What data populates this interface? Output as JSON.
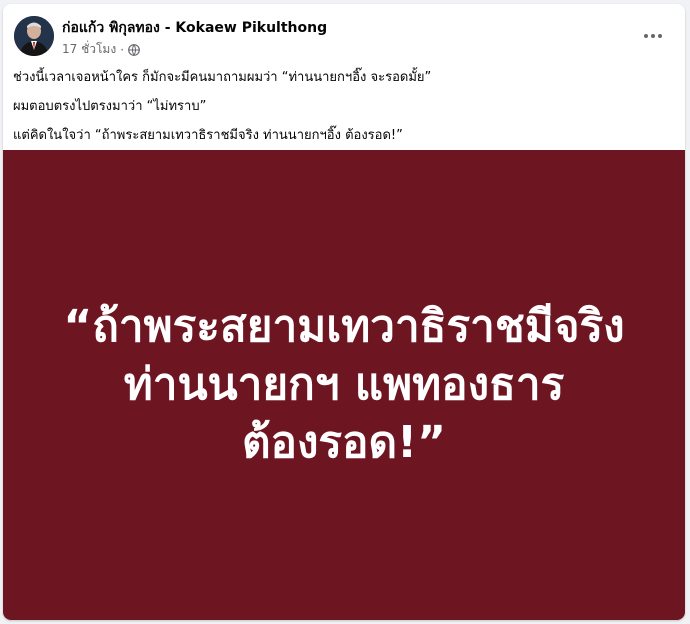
{
  "post": {
    "author": "ก่อแก้ว พิกุลทอง - Kokaew Pikulthong",
    "time": "17 ชั่วโมง",
    "separator": "·",
    "privacy_icon": "globe-icon",
    "more_icon": "more-icon",
    "text_lines": [
      "ช่วงนี้เวลาเจอหน้าใคร ก็มักจะมีคนมาถามผมว่า “ท่านนายกฯอิ๊ง จะรอดมั้ย”",
      "ผมตอบตรงไปตรงมาว่า “ไม่ทราบ”",
      "แต่คิดในใจว่า “ถ้าพระสยามเทวาธิราชมีจริง ท่านนายกฯอิ๊ง ต้องรอด!”"
    ]
  },
  "banner": {
    "lines": [
      "“ถ้าพระสยามเทวาธิราชมีจริง",
      "ท่านนายกฯ แพทองธาร",
      "ต้องรอด!”"
    ],
    "background": "#6e1522",
    "text_color": "#ffffff"
  }
}
